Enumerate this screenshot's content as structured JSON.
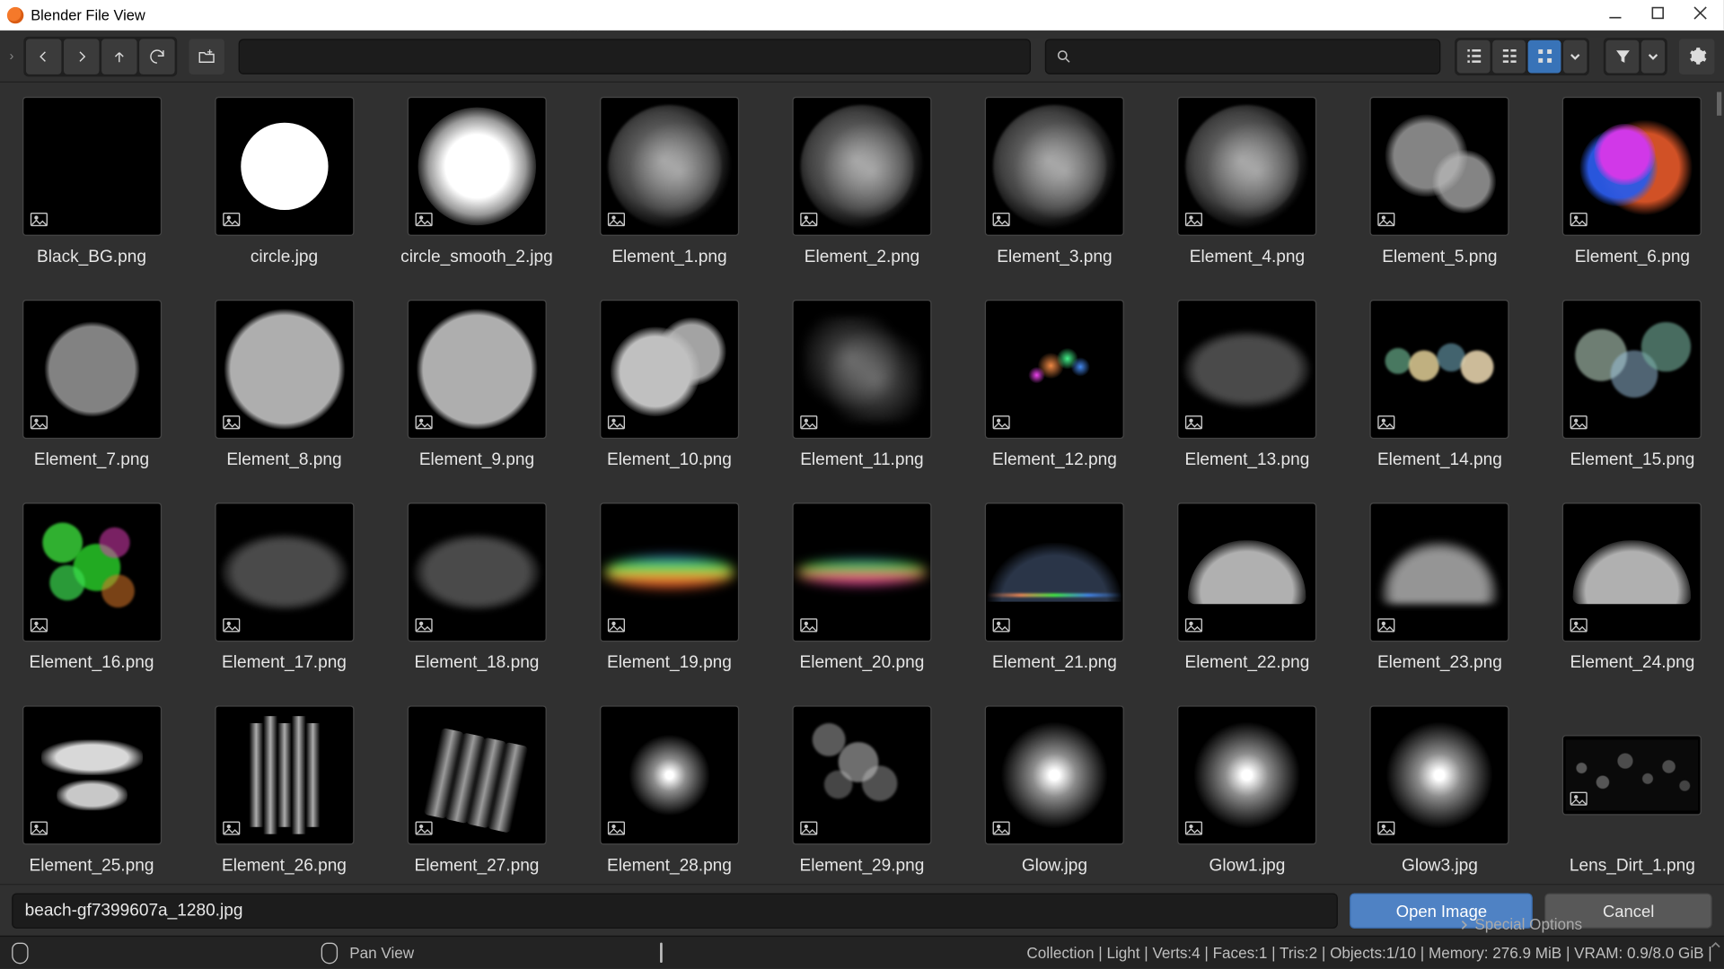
{
  "window": {
    "title": "Blender File View"
  },
  "toolbar": {
    "view_mode_active": "thumbnails"
  },
  "files": [
    {
      "name": "Black_BG.png",
      "thumb": "blank"
    },
    {
      "name": "circle.jpg",
      "thumb": "circle-solid"
    },
    {
      "name": "circle_smooth_2.jpg",
      "thumb": "circle-soft"
    },
    {
      "name": "Element_1.png",
      "thumb": "swirl"
    },
    {
      "name": "Element_2.png",
      "thumb": "swirl"
    },
    {
      "name": "Element_3.png",
      "thumb": "swirl"
    },
    {
      "name": "Element_4.png",
      "thumb": "swirl"
    },
    {
      "name": "Element_5.png",
      "thumb": "twin-soft"
    },
    {
      "name": "Element_6.png",
      "thumb": "color-magenta"
    },
    {
      "name": "Element_7.png",
      "thumb": "disc-gray-sm"
    },
    {
      "name": "Element_8.png",
      "thumb": "disc-gray"
    },
    {
      "name": "Element_9.png",
      "thumb": "disc-gray"
    },
    {
      "name": "Element_10.png",
      "thumb": "twin-disc"
    },
    {
      "name": "Element_11.png",
      "thumb": "blob-blurry"
    },
    {
      "name": "Element_12.png",
      "thumb": "color-specks"
    },
    {
      "name": "Element_13.png",
      "thumb": "oval-dark"
    },
    {
      "name": "Element_14.png",
      "thumb": "bokeh-warm"
    },
    {
      "name": "Element_15.png",
      "thumb": "bokeh-cool"
    },
    {
      "name": "Element_16.png",
      "thumb": "bokeh-green"
    },
    {
      "name": "Element_17.png",
      "thumb": "oval-dark"
    },
    {
      "name": "Element_18.png",
      "thumb": "oval-dark"
    },
    {
      "name": "Element_19.png",
      "thumb": "rainbow-orange"
    },
    {
      "name": "Element_20.png",
      "thumb": "rainbow-green"
    },
    {
      "name": "Element_21.png",
      "thumb": "rainbow-thin"
    },
    {
      "name": "Element_22.png",
      "thumb": "hemisphere"
    },
    {
      "name": "Element_23.png",
      "thumb": "hemisphere-soft"
    },
    {
      "name": "Element_24.png",
      "thumb": "hemisphere"
    },
    {
      "name": "Element_25.png",
      "thumb": "bars-h"
    },
    {
      "name": "Element_26.png",
      "thumb": "bars-v"
    },
    {
      "name": "Element_27.png",
      "thumb": "bars-diag"
    },
    {
      "name": "Element_28.png",
      "thumb": "glow-small"
    },
    {
      "name": "Element_29.png",
      "thumb": "bokeh-gray"
    },
    {
      "name": "Glow.jpg",
      "thumb": "glow"
    },
    {
      "name": "Glow1.jpg",
      "thumb": "glow"
    },
    {
      "name": "Glow3.jpg",
      "thumb": "glow"
    },
    {
      "name": "Lens_Dirt_1.png",
      "thumb": "dirt",
      "short": true
    }
  ],
  "bottom": {
    "filename_value": "beach-gf7399607a_1280.jpg",
    "open_label": "Open Image",
    "cancel_label": "Cancel"
  },
  "status": {
    "pan_label": "Pan View",
    "special_options": "Special Options",
    "stats": "Collection | Light | Verts:4 | Faces:1 | Tris:2 | Objects:1/10 | Memory: 276.9 MiB | VRAM: 0.9/8.0 GiB |"
  }
}
